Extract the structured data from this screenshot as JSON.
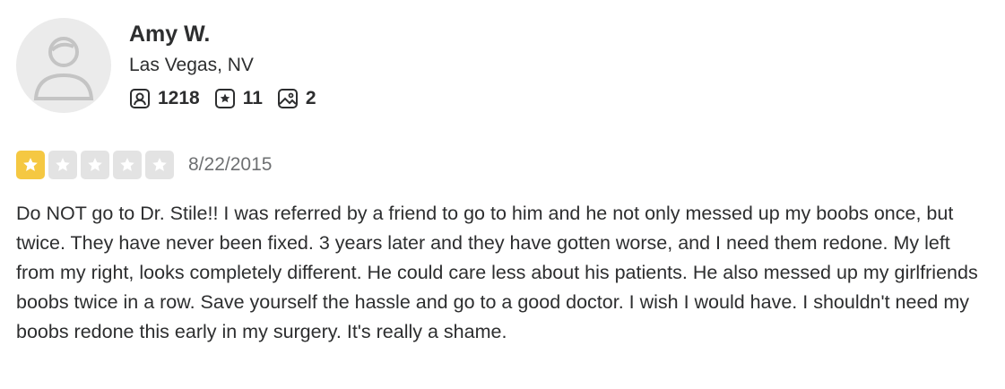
{
  "user": {
    "name": "Amy W.",
    "location": "Las Vegas, NV",
    "stats": {
      "friends": "1218",
      "reviews": "11",
      "photos": "2"
    },
    "avatar_icon": "default-user-avatar-icon"
  },
  "rating": {
    "value": 1,
    "max": 5,
    "date": "8/22/2015",
    "colors": {
      "filled": "#f5c842",
      "empty": "#e3e3e3"
    }
  },
  "review": {
    "text": "Do NOT go to Dr. Stile!! I was referred by a friend to go to him and he not only messed up my boobs once, but twice. They have never been fixed. 3 years later and they have gotten worse, and I need them redone. My left from my right, looks completely different. He could care less about his patients. He also messed up my girlfriends boobs twice in a row. Save yourself the hassle and go to a good doctor. I wish I would have. I shouldn't need my boobs redone this early in my surgery. It's really a shame."
  }
}
